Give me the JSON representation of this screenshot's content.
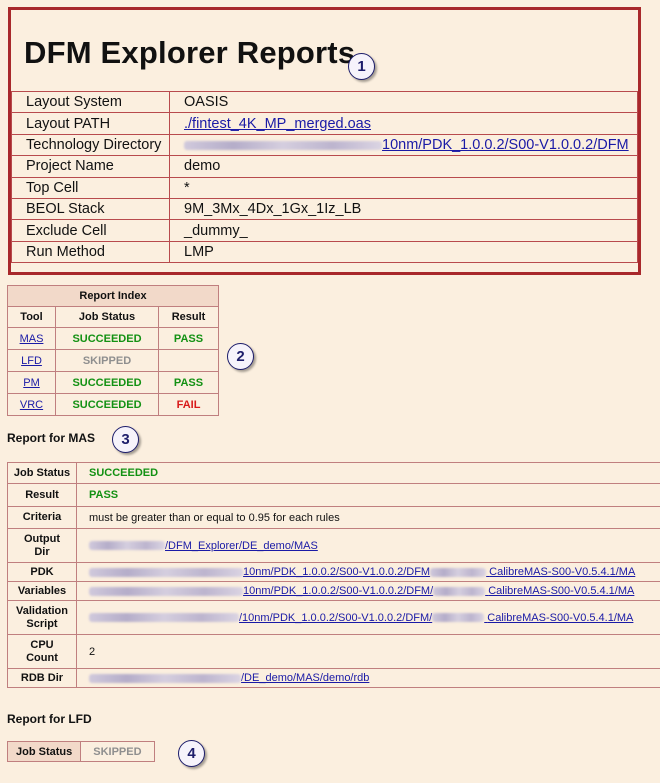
{
  "header": {
    "title": "DFM Explorer Reports",
    "callout": "1",
    "rows": [
      {
        "key": "Layout System",
        "value": "OASIS"
      },
      {
        "key": "Layout PATH",
        "value": "./fintest_4K_MP_merged.oas"
      },
      {
        "key": "Technology Directory",
        "value": "10nm/PDK_1.0.0.2/S00-V1.0.0.2/DFM"
      },
      {
        "key": "Project Name",
        "value": "demo"
      },
      {
        "key": "Top Cell",
        "value": "*"
      },
      {
        "key": "BEOL Stack",
        "value": "9M_3Mx_4Dx_1Gx_1Iz_LB"
      },
      {
        "key": "Exclude Cell",
        "value": "_dummy_"
      },
      {
        "key": "Run Method",
        "value": "LMP"
      }
    ]
  },
  "report_index": {
    "caption": "Report Index",
    "callout": "2",
    "columns": [
      "Tool",
      "Job Status",
      "Result"
    ],
    "rows": [
      {
        "tool": "MAS",
        "status": "SUCCEEDED",
        "result": "PASS"
      },
      {
        "tool": "LFD",
        "status": "SKIPPED",
        "result": ""
      },
      {
        "tool": "PM",
        "status": "SUCCEEDED",
        "result": "PASS"
      },
      {
        "tool": "VRC",
        "status": "SUCCEEDED",
        "result": "FAIL"
      }
    ]
  },
  "mas": {
    "title": "Report for MAS",
    "callout": "3",
    "job_status_label": "Job Status",
    "job_status": "SUCCEEDED",
    "result_label": "Result",
    "result": "PASS",
    "criteria_label": "Criteria",
    "criteria": "must be greater than or equal to 0.95 for each rules",
    "output_dir_label_1": "Output",
    "output_dir_label_2": "Dir",
    "output_dir": "/DFM_Explorer/DE_demo/MAS",
    "pdk_label": "PDK",
    "pdk_a": "10nm/PDK_1.0.0.2/S00-V1.0.0.2/DFM",
    "pdk_b": "CalibreMAS-S00-V0.5.4.1/MA",
    "variables_label": "Variables",
    "variables_a": "10nm/PDK_1.0.0.2/S00-V1.0.0.2/DFM/",
    "variables_b": "CalibreMAS-S00-V0.5.4.1/MA",
    "validation_label_1": "Validation",
    "validation_label_2": "Script",
    "validation_a": "/10nm/PDK_1.0.0.2/S00-V1.0.0.2/DFM/",
    "validation_b": "CalibreMAS-S00-V0.5.4.1/MA",
    "cpu_label_1": "CPU",
    "cpu_label_2": "Count",
    "cpu_count": "2",
    "rdb_label": "RDB Dir",
    "rdb_dir": "/DE_demo/MAS/demo/rdb"
  },
  "lfd": {
    "title": "Report for LFD",
    "callout": "4",
    "job_status_label": "Job Status",
    "job_status": "SKIPPED"
  },
  "colors": {
    "border_header": "#a8282b",
    "success": "#139113",
    "fail": "#d81a1a",
    "skipped": "#8f8f8f",
    "link": "#1a1aa6"
  }
}
